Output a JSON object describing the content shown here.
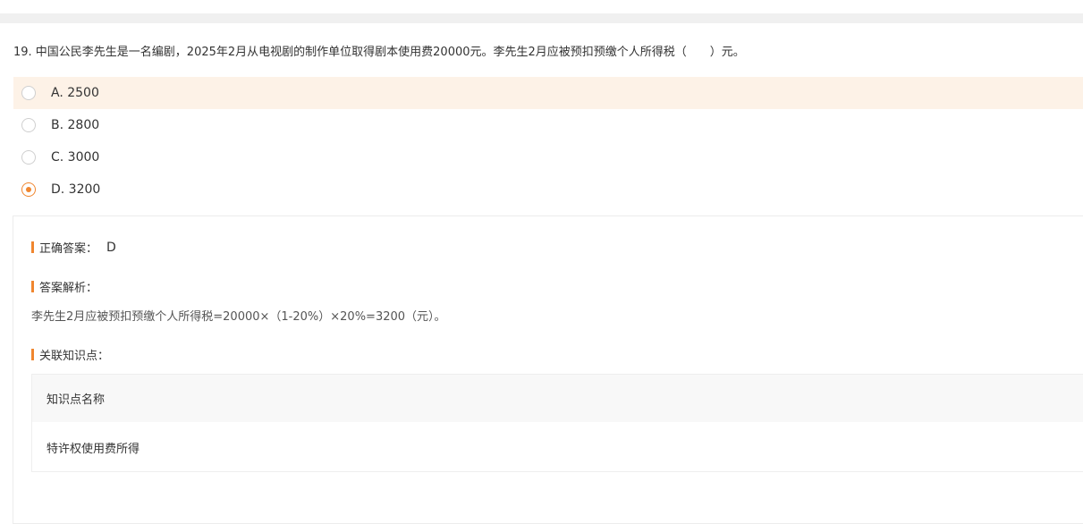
{
  "question": {
    "text": "19. 中国公民李先生是一名编剧，2025年2月从电视剧的制作单位取得剧本使用费20000元。李先生2月应被预扣预缴个人所得税（　　）元。"
  },
  "options": [
    {
      "label": "A. 2500",
      "selected": false,
      "highlighted": true
    },
    {
      "label": "B. 2800",
      "selected": false,
      "highlighted": false
    },
    {
      "label": "C. 3000",
      "selected": false,
      "highlighted": false
    },
    {
      "label": "D. 3200",
      "selected": true,
      "highlighted": false
    }
  ],
  "answer": {
    "correct_label": "正确答案：",
    "correct_value": "D",
    "analysis_label": "答案解析：",
    "analysis_text": "李先生2月应被预扣预缴个人所得税=20000×（1-20%）×20%=3200（元）。",
    "knowledge_label": "关联知识点：",
    "knowledge_table": {
      "header": "知识点名称",
      "rows": [
        "特许权使用费所得"
      ]
    }
  },
  "colors": {
    "accent": "#f0862f",
    "highlight": "#fdf2e7"
  }
}
